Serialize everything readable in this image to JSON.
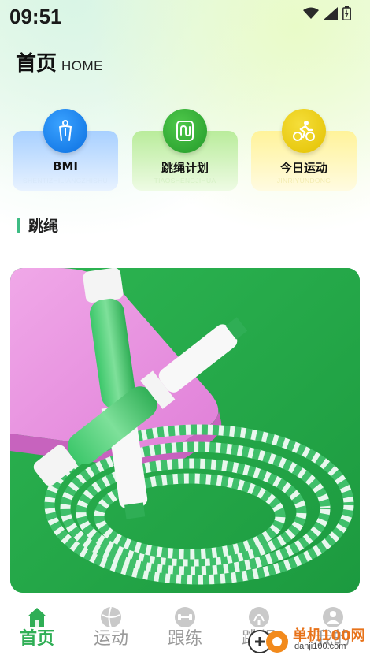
{
  "status_bar": {
    "time": "09:51"
  },
  "header": {
    "title": "首页",
    "subtitle": "HOME"
  },
  "cards": [
    {
      "title": "BMI",
      "pinyin": "SHENTIZHILIANGZHISHU",
      "icon": "body-icon",
      "color": "#0b6fe0"
    },
    {
      "title": "跳绳计划",
      "pinyin": "TIAOSHENGJIHUA",
      "icon": "jump-plan-icon",
      "color": "#249a2a"
    },
    {
      "title": "今日运动",
      "pinyin": "JINRIYUNDONG",
      "icon": "cyclist-icon",
      "color": "#e3c100"
    }
  ],
  "section": {
    "title": "跳绳",
    "accent": "#3ebc84"
  },
  "banner": {
    "image": "jump-rope-product-image"
  },
  "tabs": [
    {
      "label": "首页",
      "icon": "home-icon",
      "active": true
    },
    {
      "label": "运动",
      "icon": "ball-icon",
      "active": false
    },
    {
      "label": "跟练",
      "icon": "dumbbell-icon",
      "active": false
    },
    {
      "label": "跳绳",
      "icon": "rope-icon",
      "active": false
    },
    {
      "label": "我的",
      "icon": "person-icon",
      "active": false
    }
  ],
  "watermark": {
    "text": "单机100网",
    "url_text": "danji100.com"
  },
  "colors": {
    "active_tab": "#2fae55",
    "inactive_tab": "#9a9a9a"
  }
}
